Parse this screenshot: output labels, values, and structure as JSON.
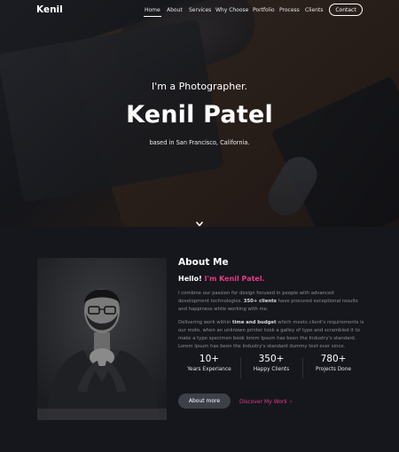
{
  "brand": {
    "name": "Kenil"
  },
  "nav": {
    "items": [
      {
        "label": "Home",
        "active": true
      },
      {
        "label": "About"
      },
      {
        "label": "Services"
      },
      {
        "label": "Why Choose"
      },
      {
        "label": "Portfolio"
      },
      {
        "label": "Process"
      },
      {
        "label": "Clients"
      }
    ],
    "contact_label": "Contact"
  },
  "hero": {
    "subtitle": "I'm a Photographer.",
    "name": "Kenil Patel",
    "location": "based in San Francisco, California.",
    "scroll_icon": "chevron-down-icon"
  },
  "about": {
    "title": "About Me",
    "hello_prefix": "Hello!",
    "hello_name": "I'm Kenil Patel.",
    "para1": {
      "text_before": "I combine our passion for design focused in people with advanced development technologies.",
      "bold": "350+ clients",
      "text_after": "have procured exceptional results and happiness while working with me."
    },
    "para2": {
      "text_before": "Delivering work within",
      "bold": "time and budget",
      "text_after": "which meets client's requirements is our moto. when an unknown printer took a galley of type and scrambled it to make a type specimen book lorem Ipsum has been the Industry's standard. Lorem Ipsum has been the Industry's standard dummy text ever since."
    },
    "stats": [
      {
        "value": "10+",
        "label": "Years Experiance"
      },
      {
        "value": "350+",
        "label": "Happy Clients"
      },
      {
        "value": "780+",
        "label": "Projects Done"
      }
    ],
    "more_label": "About more",
    "discover_label": "Discover My Work",
    "discover_icon": "chevron-right-icon"
  },
  "colors": {
    "accent": "#e8378a",
    "background": "#15171c",
    "button": "#3d4047"
  }
}
